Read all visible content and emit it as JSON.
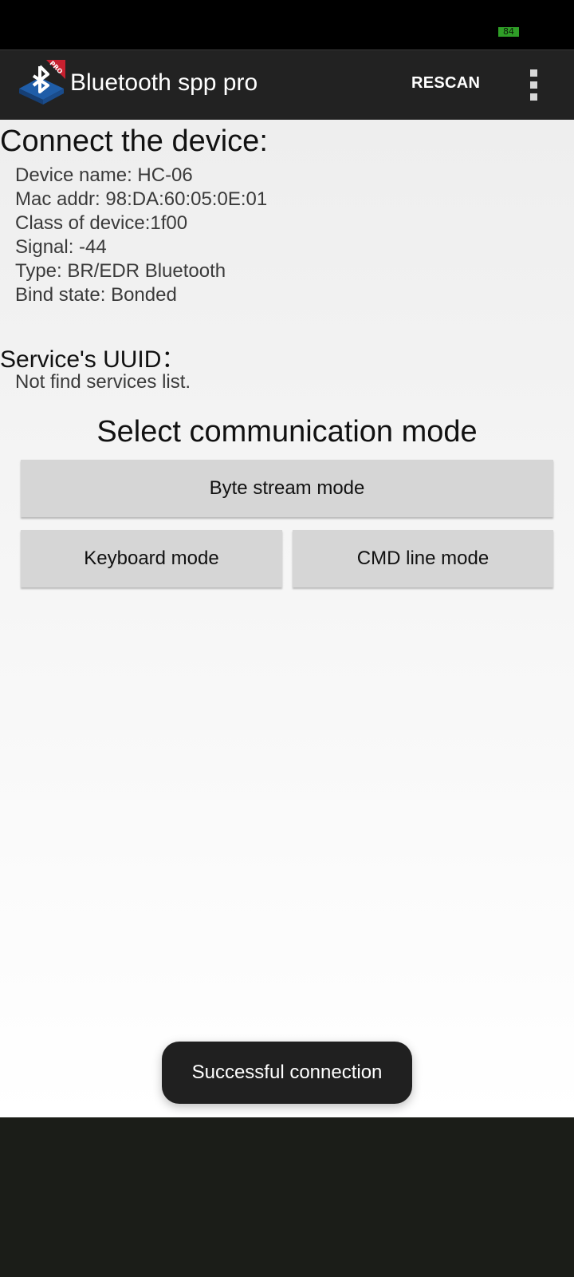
{
  "status_bar": {
    "battery_level": "84"
  },
  "app_bar": {
    "title": "Bluetooth spp pro",
    "icon_badge": "PRO",
    "rescan_label": "RESCAN",
    "menu_icon": "more-vert-icon"
  },
  "device": {
    "heading": "Connect the device:",
    "lines": [
      "Device name: HC-06",
      "Mac addr: 98:DA:60:05:0E:01",
      "Class of device:1f00",
      "Signal: -44",
      "Type: BR/EDR Bluetooth",
      "Bind state: Bonded"
    ]
  },
  "services": {
    "heading": "Service's UUID：",
    "message": "Not find services list."
  },
  "modes": {
    "heading": "Select communication mode",
    "byte_stream_label": "Byte stream mode",
    "keyboard_label": "Keyboard mode",
    "cmd_line_label": "CMD line mode"
  },
  "toast": {
    "message": "Successful connection"
  },
  "colors": {
    "app_bar_bg": "#222222",
    "button_bg": "#d6d6d6",
    "battery_green": "#2f9e27"
  }
}
